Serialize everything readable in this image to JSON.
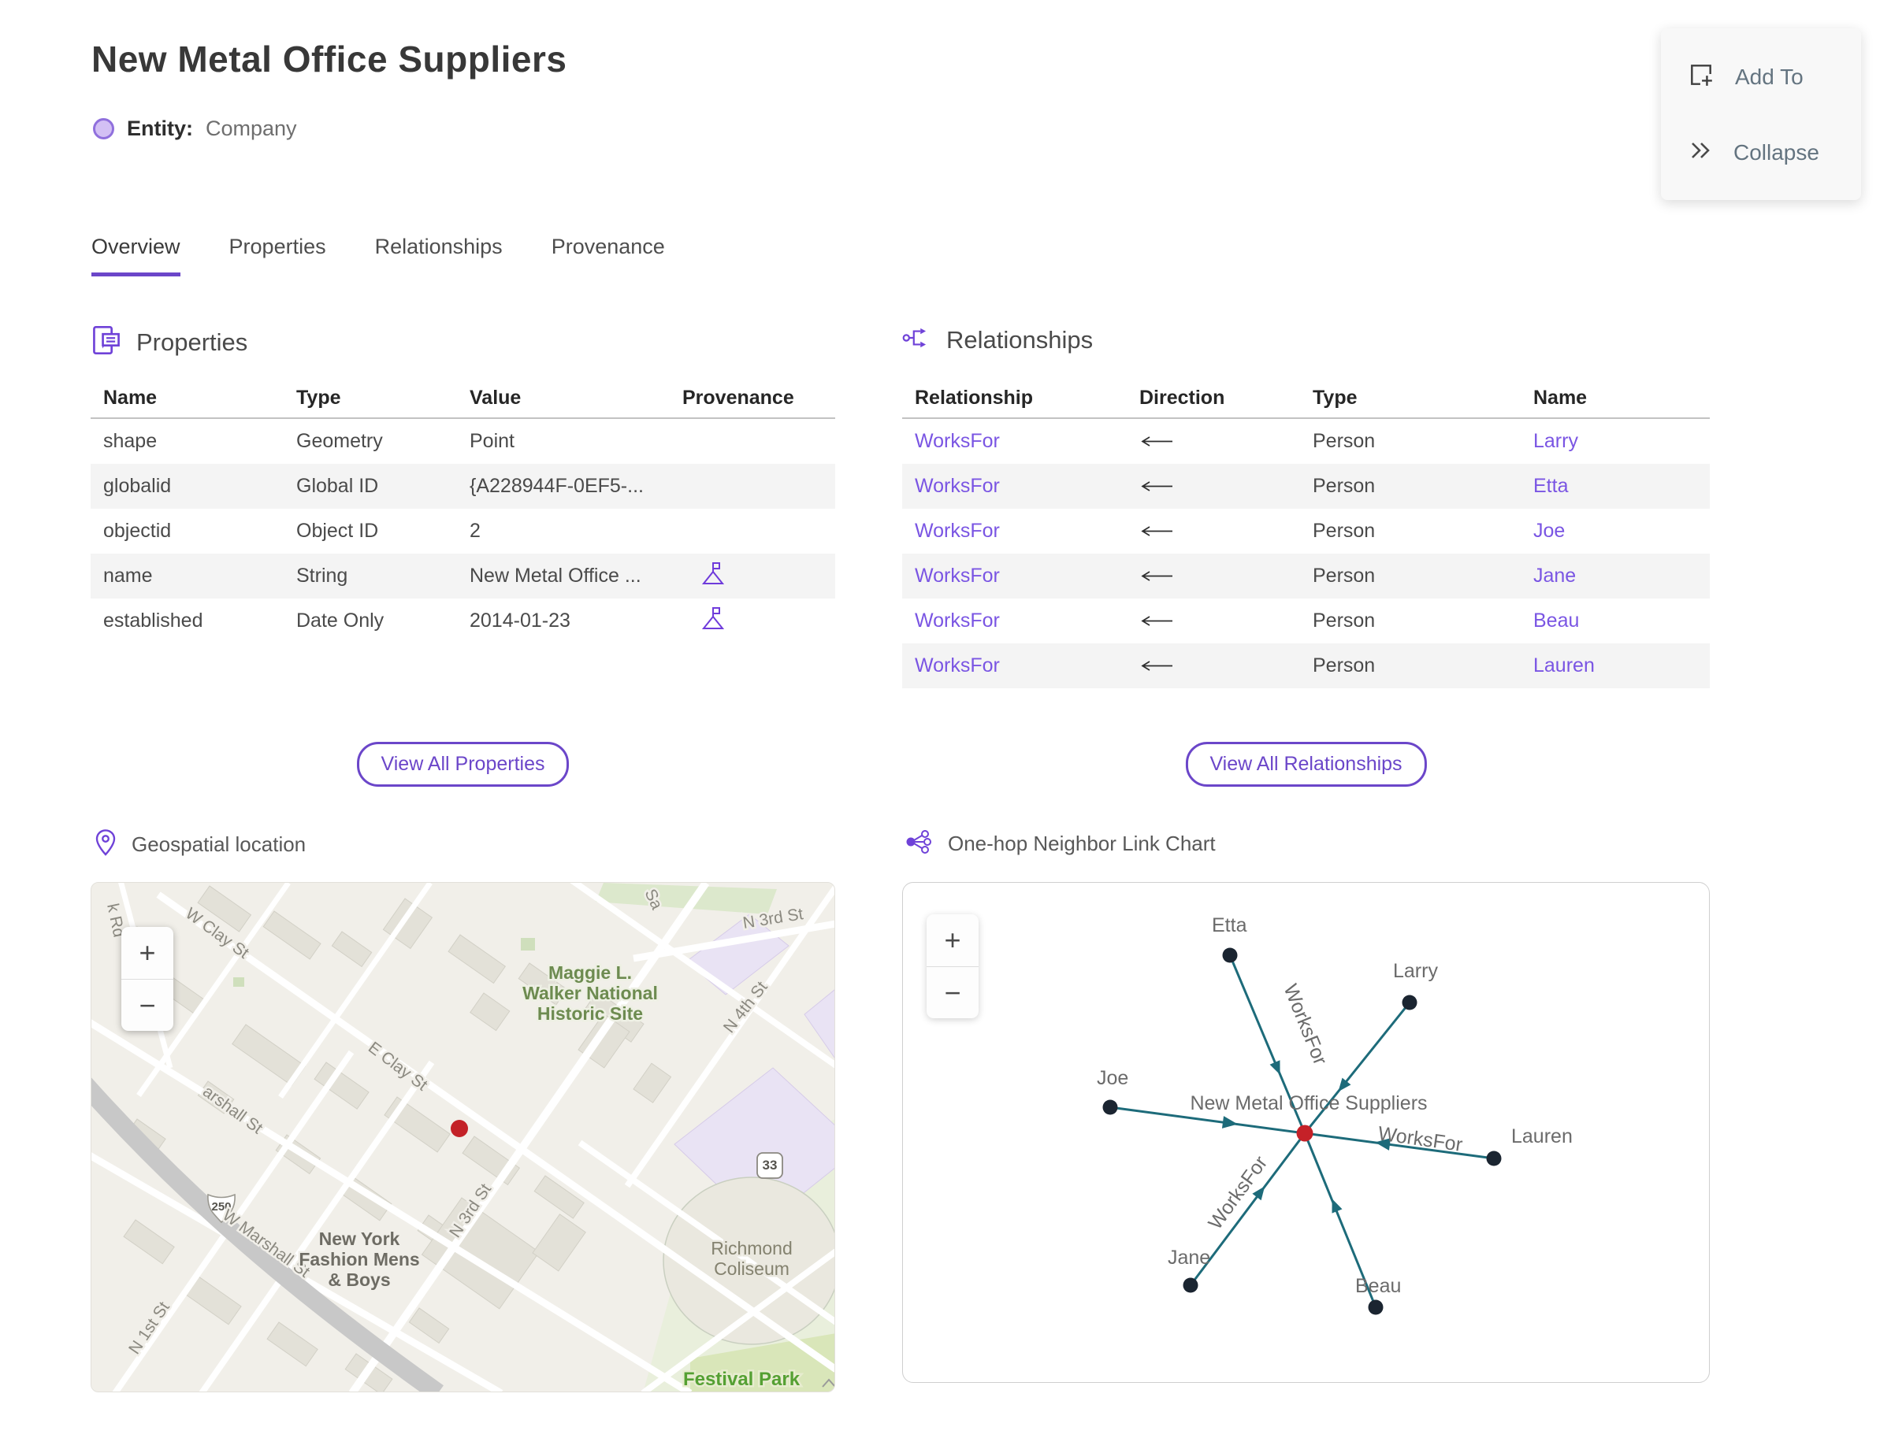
{
  "header": {
    "title": "New Metal Office Suppliers",
    "entity_label": "Entity:",
    "entity_type": "Company"
  },
  "actions": {
    "add_to": "Add To",
    "collapse": "Collapse"
  },
  "tabs": {
    "overview": "Overview",
    "properties": "Properties",
    "relationships": "Relationships",
    "provenance": "Provenance"
  },
  "properties_section": {
    "title": "Properties",
    "columns": {
      "name": "Name",
      "type": "Type",
      "value": "Value",
      "provenance": "Provenance"
    },
    "rows": [
      {
        "name": "shape",
        "type": "Geometry",
        "value": "Point",
        "has_provenance_icon": false
      },
      {
        "name": "globalid",
        "type": "Global ID",
        "value": "{A228944F-0EF5-...",
        "has_provenance_icon": false
      },
      {
        "name": "objectid",
        "type": "Object ID",
        "value": "2",
        "has_provenance_icon": false
      },
      {
        "name": "name",
        "type": "String",
        "value": "New Metal Office ...",
        "has_provenance_icon": true
      },
      {
        "name": "established",
        "type": "Date Only",
        "value": "2014-01-23",
        "has_provenance_icon": true
      }
    ],
    "view_all": "View All Properties"
  },
  "relationships_section": {
    "title": "Relationships",
    "columns": {
      "relationship": "Relationship",
      "direction": "Direction",
      "type": "Type",
      "name": "Name"
    },
    "rows": [
      {
        "relationship": "WorksFor",
        "direction": "←",
        "type": "Person",
        "name": "Larry"
      },
      {
        "relationship": "WorksFor",
        "direction": "←",
        "type": "Person",
        "name": "Etta"
      },
      {
        "relationship": "WorksFor",
        "direction": "←",
        "type": "Person",
        "name": "Joe"
      },
      {
        "relationship": "WorksFor",
        "direction": "←",
        "type": "Person",
        "name": "Jane"
      },
      {
        "relationship": "WorksFor",
        "direction": "←",
        "type": "Person",
        "name": "Beau"
      },
      {
        "relationship": "WorksFor",
        "direction": "←",
        "type": "Person",
        "name": "Lauren"
      }
    ],
    "view_all": "View All Relationships"
  },
  "map_section": {
    "title": "Geospatial location",
    "zoom_in": "+",
    "zoom_out": "−",
    "streets": {
      "k_rd": "k Rd",
      "w_clay": "W Clay St",
      "sa": "Sa",
      "marshall": "arshall St",
      "w_marshall": "W Marshall St",
      "e_clay": "E Clay St",
      "n_3rd_top": "N 3rd St",
      "n_4th": "N 4th St",
      "n_3rd": "N 3rd St",
      "n_1st": "N 1st St"
    },
    "shields": {
      "us_250": "250",
      "va_33": "33"
    },
    "poi": {
      "historic_site": [
        "Maggie L.",
        "Walker National",
        "Historic Site"
      ],
      "store": [
        "New York",
        "Fashion Mens",
        "& Boys"
      ],
      "coliseum": [
        "Richmond",
        "Coliseum"
      ],
      "festival_park": "Festival Park"
    }
  },
  "link_chart_section": {
    "title": "One-hop Neighbor Link Chart",
    "zoom_in": "+",
    "zoom_out": "−",
    "center_label": "New Metal Office Suppliers",
    "edge_label": "WorksFor",
    "nodes": [
      "Etta",
      "Larry",
      "Joe",
      "Lauren",
      "Jane",
      "Beau"
    ],
    "colors": {
      "edge": "#1d6b7a",
      "node": "#1b2531",
      "center_node": "#c52128"
    }
  },
  "theme": {
    "accent_purple": "#7650d9",
    "tab_underline": "#6b46c9",
    "link_purple": "#7a55e3",
    "marker_red": "#c32127"
  }
}
